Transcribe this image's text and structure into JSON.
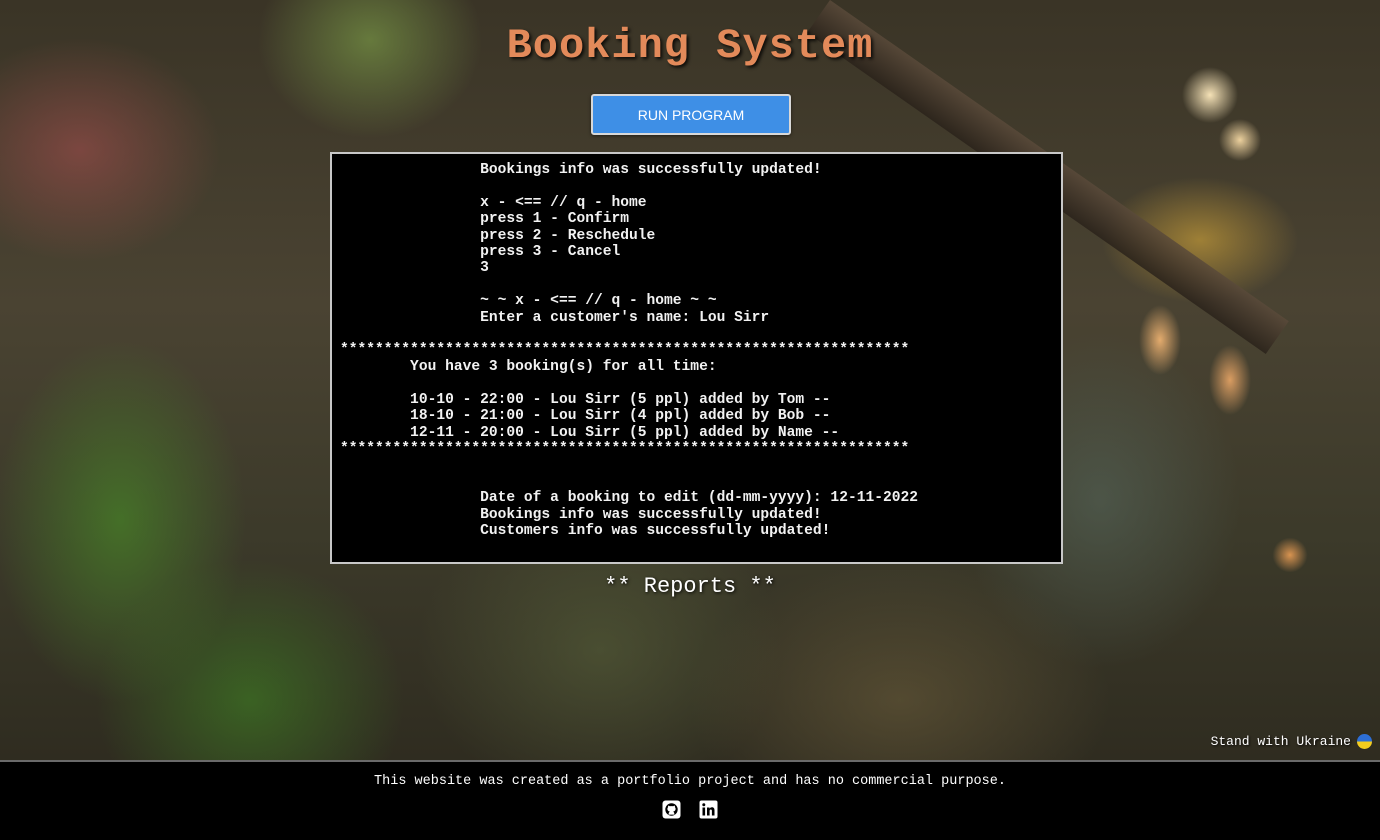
{
  "header": {
    "title": "Booking System",
    "run_button_label": "RUN PROGRAM"
  },
  "terminal": {
    "output": "                Bookings info was successfully updated!\n\n                x - <== // q - home\n                press 1 - Confirm\n                press 2 - Reschedule\n                press 3 - Cancel\n                3\n\n                ~ ~ x - <== // q - home ~ ~\n                Enter a customer's name: Lou Sirr\n\n*****************************************************************\n        You have 3 booking(s) for all time:\n\n        10-10 - 22:00 - Lou Sirr (5 ppl) added by Tom --\n        18-10 - 21:00 - Lou Sirr (4 ppl) added by Bob --\n        12-11 - 20:00 - Lou Sirr (5 ppl) added by Name --\n*****************************************************************\n\n\n                Date of a booking to edit (dd-mm-yyyy): 12-11-2022\n                Bookings info was successfully updated!\n                Customers info was successfully updated!"
  },
  "reports_label": "** Reports **",
  "ukraine_label": "Stand with Ukraine",
  "footer": {
    "text": "This website was created as a portfolio project and has no commercial purpose.",
    "icons": [
      "github-icon",
      "linkedin-icon"
    ]
  },
  "colors": {
    "title": "#e38a5a",
    "button": "#3e8fe6",
    "terminal_bg": "#000000",
    "footer_bg": "#000000",
    "flag_blue": "#2d6fd6",
    "flag_yellow": "#f4cd1f"
  }
}
